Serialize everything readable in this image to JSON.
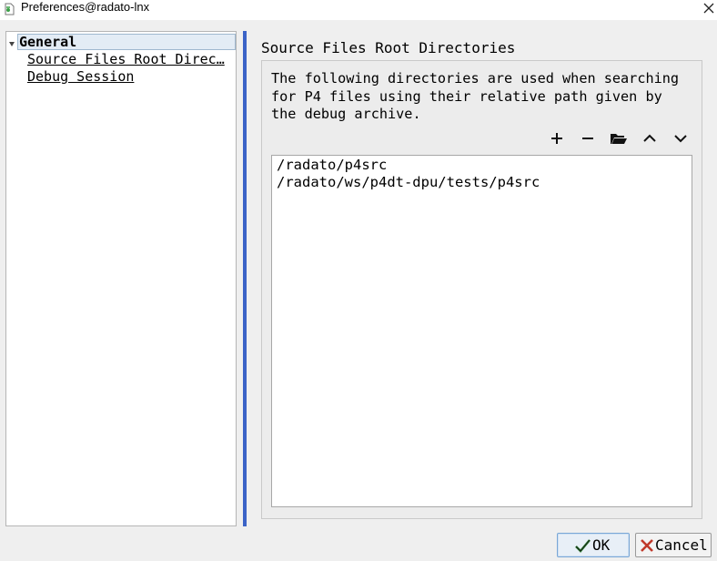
{
  "window": {
    "title": "Preferences@radato-lnx"
  },
  "tree": {
    "items": [
      {
        "label": "General",
        "level": 0,
        "selected": true
      },
      {
        "label": "Source Files Root Direc…",
        "level": 1
      },
      {
        "label": "Debug Session",
        "level": 1
      }
    ]
  },
  "main": {
    "section_title": "Source Files Root Directories",
    "description_lines": [
      "The following directories are used when searching",
      "for P4 files using their relative path given by",
      "the debug archive."
    ],
    "toolbar_icons": [
      "add-icon",
      "remove-icon",
      "folder-open-icon",
      "move-up-icon",
      "move-down-icon"
    ],
    "directories": [
      "/radato/p4src",
      "/radato/ws/p4dt-dpu/tests/p4src"
    ]
  },
  "buttons": {
    "ok_label": "OK",
    "cancel_label": "Cancel"
  },
  "colors": {
    "accent_bar": "#3b63c7",
    "cancel_x": "#c0392b",
    "selection_bg": "#e3ecf5"
  }
}
